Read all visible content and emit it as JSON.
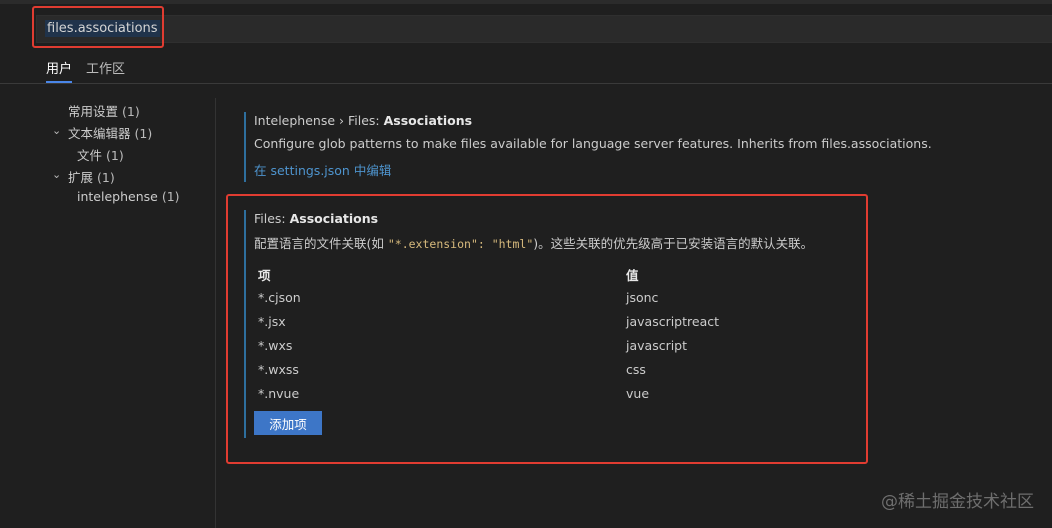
{
  "search": {
    "value": "files.associations"
  },
  "tabs": [
    {
      "label": "用户",
      "active": true
    },
    {
      "label": "工作区",
      "active": false
    }
  ],
  "toc": [
    {
      "label": "常用设置",
      "count": "(1)"
    },
    {
      "label": "文本编辑器",
      "count": "(1)",
      "expanded": true
    },
    {
      "label": "文件",
      "count": "(1)"
    },
    {
      "label": "扩展",
      "count": "(1)",
      "expanded": true
    },
    {
      "label": "intelephense",
      "count": "(1)"
    }
  ],
  "intelephense_setting": {
    "category": "Intelephense › Files: ",
    "name": "Associations",
    "description": "Configure glob patterns to make files available for language server features. Inherits from files.associations.",
    "edit_link": "在 settings.json 中编辑"
  },
  "files_setting": {
    "category": "Files: ",
    "name": "Associations",
    "description_prefix": "配置语言的文件关联(如 ",
    "description_code": "\"*.extension\": \"html\"",
    "description_suffix": ")。这些关联的优先级高于已安装语言的默认关联。",
    "columns": [
      "项",
      "值"
    ],
    "rows": [
      {
        "item": "*.cjson",
        "value": "jsonc"
      },
      {
        "item": "*.jsx",
        "value": "javascriptreact"
      },
      {
        "item": "*.wxs",
        "value": "javascript"
      },
      {
        "item": "*.wxss",
        "value": "css"
      },
      {
        "item": "*.nvue",
        "value": "vue"
      }
    ],
    "add_button": "添加项"
  },
  "watermark": "@稀土掘金技术社区",
  "colors": {
    "accent": "#3d76c7",
    "link": "#4e94ce",
    "highlight": "#e03c31",
    "background": "#1f1f1f"
  }
}
